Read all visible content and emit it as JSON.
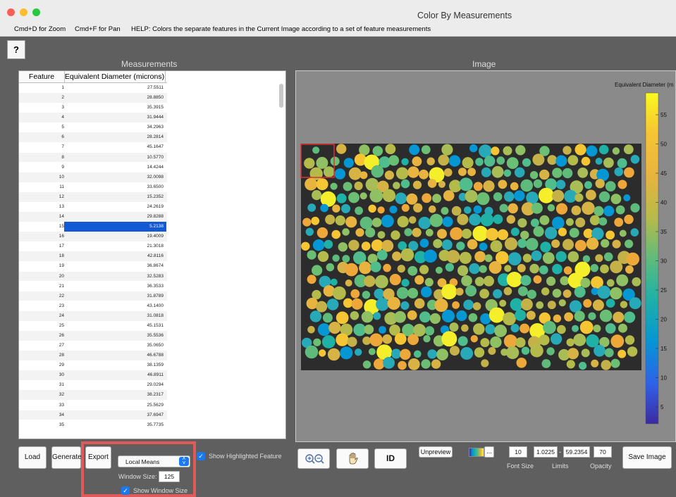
{
  "window": {
    "title": "Color By Measurements"
  },
  "menubar": {
    "zoom": "Cmd+D for Zoom",
    "pan": "Cmd+F for Pan",
    "help": "HELP:  Colors the separate features in the Current Image according to a set of feature measurements"
  },
  "help_button": "?",
  "measurements": {
    "title": "Measurements",
    "columns": [
      "Feature",
      "Equivalent Diameter (microns)"
    ],
    "selected_row": 15,
    "rows": [
      [
        1,
        "27.5511"
      ],
      [
        2,
        "28.8850"
      ],
      [
        3,
        "35.3915"
      ],
      [
        4,
        "31.9444"
      ],
      [
        5,
        "34.2963"
      ],
      [
        6,
        "28.2814"
      ],
      [
        7,
        "45.1647"
      ],
      [
        8,
        "10.5770"
      ],
      [
        9,
        "14.4244"
      ],
      [
        10,
        "32.0098"
      ],
      [
        11,
        "33.6500"
      ],
      [
        12,
        "15.2352"
      ],
      [
        13,
        "24.2619"
      ],
      [
        14,
        "29.8288"
      ],
      [
        15,
        "5.2138"
      ],
      [
        16,
        "19.4009"
      ],
      [
        17,
        "21.3018"
      ],
      [
        18,
        "42.8116"
      ],
      [
        19,
        "36.8674"
      ],
      [
        20,
        "32.5283"
      ],
      [
        21,
        "36.3533"
      ],
      [
        22,
        "31.8789"
      ],
      [
        23,
        "43.1400"
      ],
      [
        24,
        "31.0818"
      ],
      [
        25,
        "45.1531"
      ],
      [
        26,
        "35.5536"
      ],
      [
        27,
        "35.0650"
      ],
      [
        28,
        "46.6788"
      ],
      [
        29,
        "38.1359"
      ],
      [
        30,
        "46.8911"
      ],
      [
        31,
        "29.0294"
      ],
      [
        32,
        "38.2317"
      ],
      [
        33,
        "25.5629"
      ],
      [
        34,
        "37.6947"
      ],
      [
        35,
        "35.7735"
      ]
    ]
  },
  "image": {
    "title": "Image",
    "colorbar_label": "Equivalent Diameter (m",
    "colorbar_ticks": [
      "55",
      "50",
      "45",
      "40",
      "35",
      "30",
      "25",
      "20",
      "15",
      "10",
      "5"
    ]
  },
  "controls": {
    "load": "Load",
    "generate": "Generate",
    "export": "Export",
    "mode_select": "Local Means",
    "window_size_label": "Window Size:",
    "window_size_value": "125",
    "show_window_size": "Show Window Size",
    "show_highlighted": "Show Highlighted Feature",
    "id_button": "ID",
    "unpreview": "Unpreview",
    "colormap_more": "...",
    "font_size_value": "10",
    "limit_min": "1.0225",
    "limit_sep": "-",
    "limit_max": "59.2354",
    "opacity_value": "70",
    "font_size_label": "Font Size",
    "limits_label": "Limits",
    "opacity_label": "Opacity",
    "save_image": "Save Image"
  },
  "colors": {
    "highlight": "#e05a5a",
    "selection": "#1359d6",
    "check": "#1a78f0"
  }
}
